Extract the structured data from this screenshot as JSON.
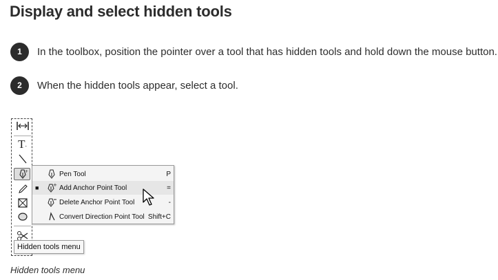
{
  "title": "Display and select hidden tools",
  "steps": [
    {
      "number": "1",
      "text": "In the toolbox, position the pointer over a tool that has hidden tools and hold down the mouse button."
    },
    {
      "number": "2",
      "text": "When the hidden tools appear, select a tool."
    }
  ],
  "toolbox": {
    "tools": [
      "gap-tool",
      "type-tool",
      "line-tool",
      "pen-tool",
      "pencil-tool",
      "rectangle-frame-tool",
      "ellipse-tool",
      "scissors-tool"
    ]
  },
  "hidden_tools_menu": {
    "items": [
      {
        "label": "Pen Tool",
        "shortcut": "P",
        "checked": false,
        "icon": "pen-icon"
      },
      {
        "label": "Add Anchor Point Tool",
        "shortcut": "=",
        "checked": true,
        "icon": "add-anchor-point-icon"
      },
      {
        "label": "Delete Anchor Point Tool",
        "shortcut": "-",
        "checked": false,
        "icon": "delete-anchor-point-icon"
      },
      {
        "label": "Convert Direction Point Tool",
        "shortcut": "Shift+C",
        "checked": false,
        "icon": "convert-direction-point-icon"
      }
    ]
  },
  "tooltip": "Hidden tools menu",
  "caption": "Hidden tools menu"
}
